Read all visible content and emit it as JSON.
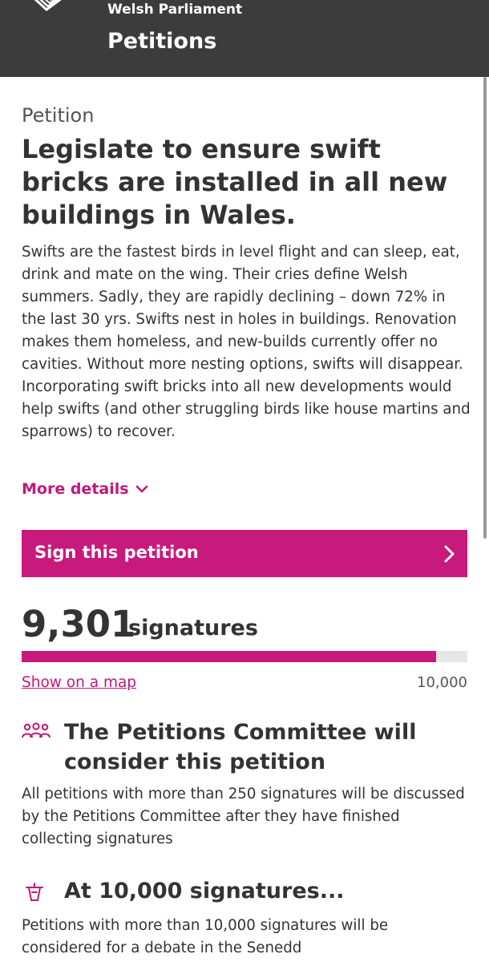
{
  "header": {
    "org_name": "Welsh Parliament",
    "site_title": "Petitions"
  },
  "petition": {
    "kicker": "Petition",
    "title": "Legislate to ensure swift bricks are installed in all new buildings in Wales.",
    "body": "Swifts are the fastest birds in level flight and can sleep, eat, drink and mate on the wing. Their cries define Welsh summers. Sadly, they are rapidly declining – down 72% in the last 30 yrs. Swifts nest in holes in buildings. Renovation makes them homeless, and new-builds currently offer no cavities. Without more nesting options, swifts will disappear. Incorporating swift bricks into all new developments would help swifts (and other struggling birds like house martins and sparrows) to recover.",
    "more_details_label": "More details"
  },
  "sign_button": {
    "label": "Sign this petition"
  },
  "signatures": {
    "count": "9,301",
    "label": "signatures",
    "progress_fraction": 0.9301,
    "show_map_label": "Show on a map",
    "target": "10,000"
  },
  "committee": {
    "heading": "The Petitions Committee will consider this petition",
    "text": "All petitions with more than 250 signatures will be discussed by the Petitions Committee after they have finished collecting signatures"
  },
  "debate": {
    "heading": "At 10,000 signatures...",
    "text": "Petitions with more than 10,000 signatures will be considered for a debate in the Senedd"
  },
  "colors": {
    "header_bg": "#3c3c3c",
    "accent": "#c8197c",
    "text": "#333333"
  },
  "icons": {
    "logo": "welsh-parliament-logo",
    "more_details": "chevron-down-icon",
    "sign": "chevron-right-icon",
    "committee": "people-group-icon",
    "debate": "podium-icon"
  }
}
